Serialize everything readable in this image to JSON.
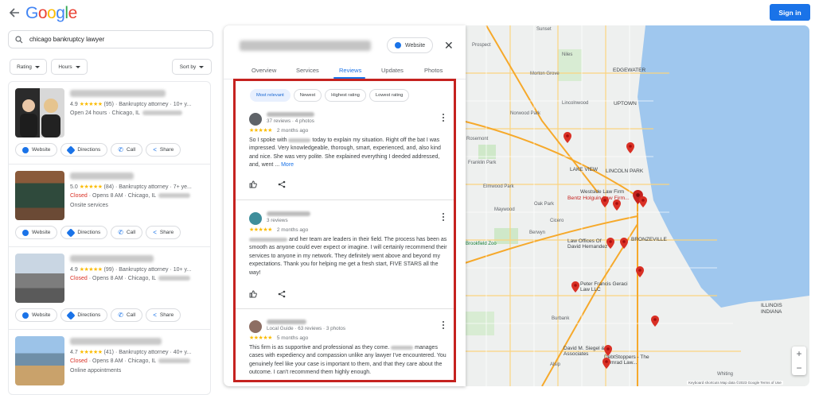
{
  "header": {
    "logo": "Google",
    "signin_label": "Sign in"
  },
  "search": {
    "query": "chicago bankruptcy lawyer"
  },
  "filters": {
    "rating": "Rating",
    "hours": "Hours",
    "sort": "Sort by"
  },
  "results": [
    {
      "rating": "4.9",
      "stars": "★★★★★",
      "count": "(95)",
      "category": "· Bankruptcy attorney · 10+ y...",
      "status": "Open 24 hours",
      "status_color": "#5f6368",
      "location": "· Chicago, IL",
      "extra": ""
    },
    {
      "rating": "5.0",
      "stars": "★★★★★",
      "count": "(84)",
      "category": "· Bankruptcy attorney · 7+ ye...",
      "status": "Closed",
      "status_color": "#d93025",
      "location": "· Opens 8 AM · Chicago, IL",
      "extra": "Onsite services"
    },
    {
      "rating": "4.9",
      "stars": "★★★★★",
      "count": "(99)",
      "category": "· Bankruptcy attorney · 10+ y...",
      "status": "Closed",
      "status_color": "#d93025",
      "location": "· Opens 8 AM · Chicago, IL",
      "extra": ""
    },
    {
      "rating": "4.7",
      "stars": "★★★★★",
      "count": "(41)",
      "category": "· Bankruptcy attorney · 40+ y...",
      "status": "Closed",
      "status_color": "#d93025",
      "location": "· Opens 8 AM · Chicago, IL",
      "extra": "Online appointments"
    }
  ],
  "result_actions": {
    "website": "Website",
    "directions": "Directions",
    "call": "Call",
    "share": "Share"
  },
  "panel": {
    "website_label": "Website",
    "close_symbol": "✕",
    "tabs": [
      "Overview",
      "Services",
      "Reviews",
      "Updates",
      "Photos"
    ],
    "active_tab": "Reviews",
    "chips": [
      "Most relevant",
      "Newest",
      "Highest rating",
      "Lowest rating"
    ]
  },
  "reviews": [
    {
      "meta": "37 reviews · 4 photos",
      "stars": "★★★★★",
      "when": "2 months ago",
      "text_before": "So I spoke with",
      "text_after": "today to explain my situation. Right off the bat I was impressed. Very knowledgeable, thorough, smart, experienced, and, also kind and nice. She was very polite. She explained everything I deeded addressed, and, went ...",
      "more": "More"
    },
    {
      "meta": "3 reviews",
      "stars": "★★★★★",
      "when": "2 months ago",
      "text_before": "",
      "text_after": "and her team are leaders in their field. The process has been as smooth as anyone could ever expect or imagine. I will certainly recommend their services to anyone in my network. They definitely went above and beyond my expectations. Thank you for helping me get a fresh start, FIVE STARS all the way!",
      "more": ""
    },
    {
      "meta": "Local Guide · 63 reviews · 3 photos",
      "stars": "★★★★★",
      "when": "5 months ago",
      "text_before": "This firm is as supportive and professional as they come.",
      "text_after": "manages cases with expediency and compassion unlike any lawyer I've encountered. You genuinely feel like your case is important to them, and that they care about the outcome. I can't recommend them highly enough.",
      "more": ""
    }
  ],
  "map": {
    "labels": {
      "sunset": "Sunset",
      "prospect": "Prospect",
      "norwood": "Norwood Park",
      "edgewater": "EDGEWATER",
      "uptown": "UPTOWN",
      "morton": "Morton Grove",
      "lincolnwood": "Lincolnwood",
      "niles": "Niles",
      "rosemont": "Rosemont",
      "franklin": "Franklin Park",
      "lakeview": "LAKE VIEW",
      "lincolnpark": "LINCOLN PARK",
      "elmwood": "Elmwood Park",
      "oakpark": "Oak Park",
      "maywood": "Maywood",
      "westside": "Westside Law Firm",
      "bentz": "Bentz Holguin Law Firm...",
      "berwyn": "Berwyn",
      "cicero": "Cicero",
      "lawoffices": "Law Offices Of David Hernandez",
      "brookfield": "Brookfield Zoo",
      "bronzeville": "BRONZEVILLE",
      "peter": "Peter Francis Geraci Law LLC",
      "illinois": "ILLINOIS",
      "indiana": "INDIANA",
      "burbank": "Burbank",
      "davidsiegel": "David M. Siegel & Associates",
      "debtstoppers": "DebtStoppers - The Semrad Law...",
      "alsip": "Alsip",
      "whiting": "Whiting",
      "chicago_logo": "Chicago"
    },
    "zoom_in": "+",
    "zoom_out": "−",
    "attribution": "Keyboard shortcuts    Map data ©2023 Google    Terms of Use"
  },
  "colors": {
    "accent": "#1a73e8",
    "highlight_border": "#c5221f",
    "pin": "#d93025",
    "star": "#fbbc04"
  }
}
